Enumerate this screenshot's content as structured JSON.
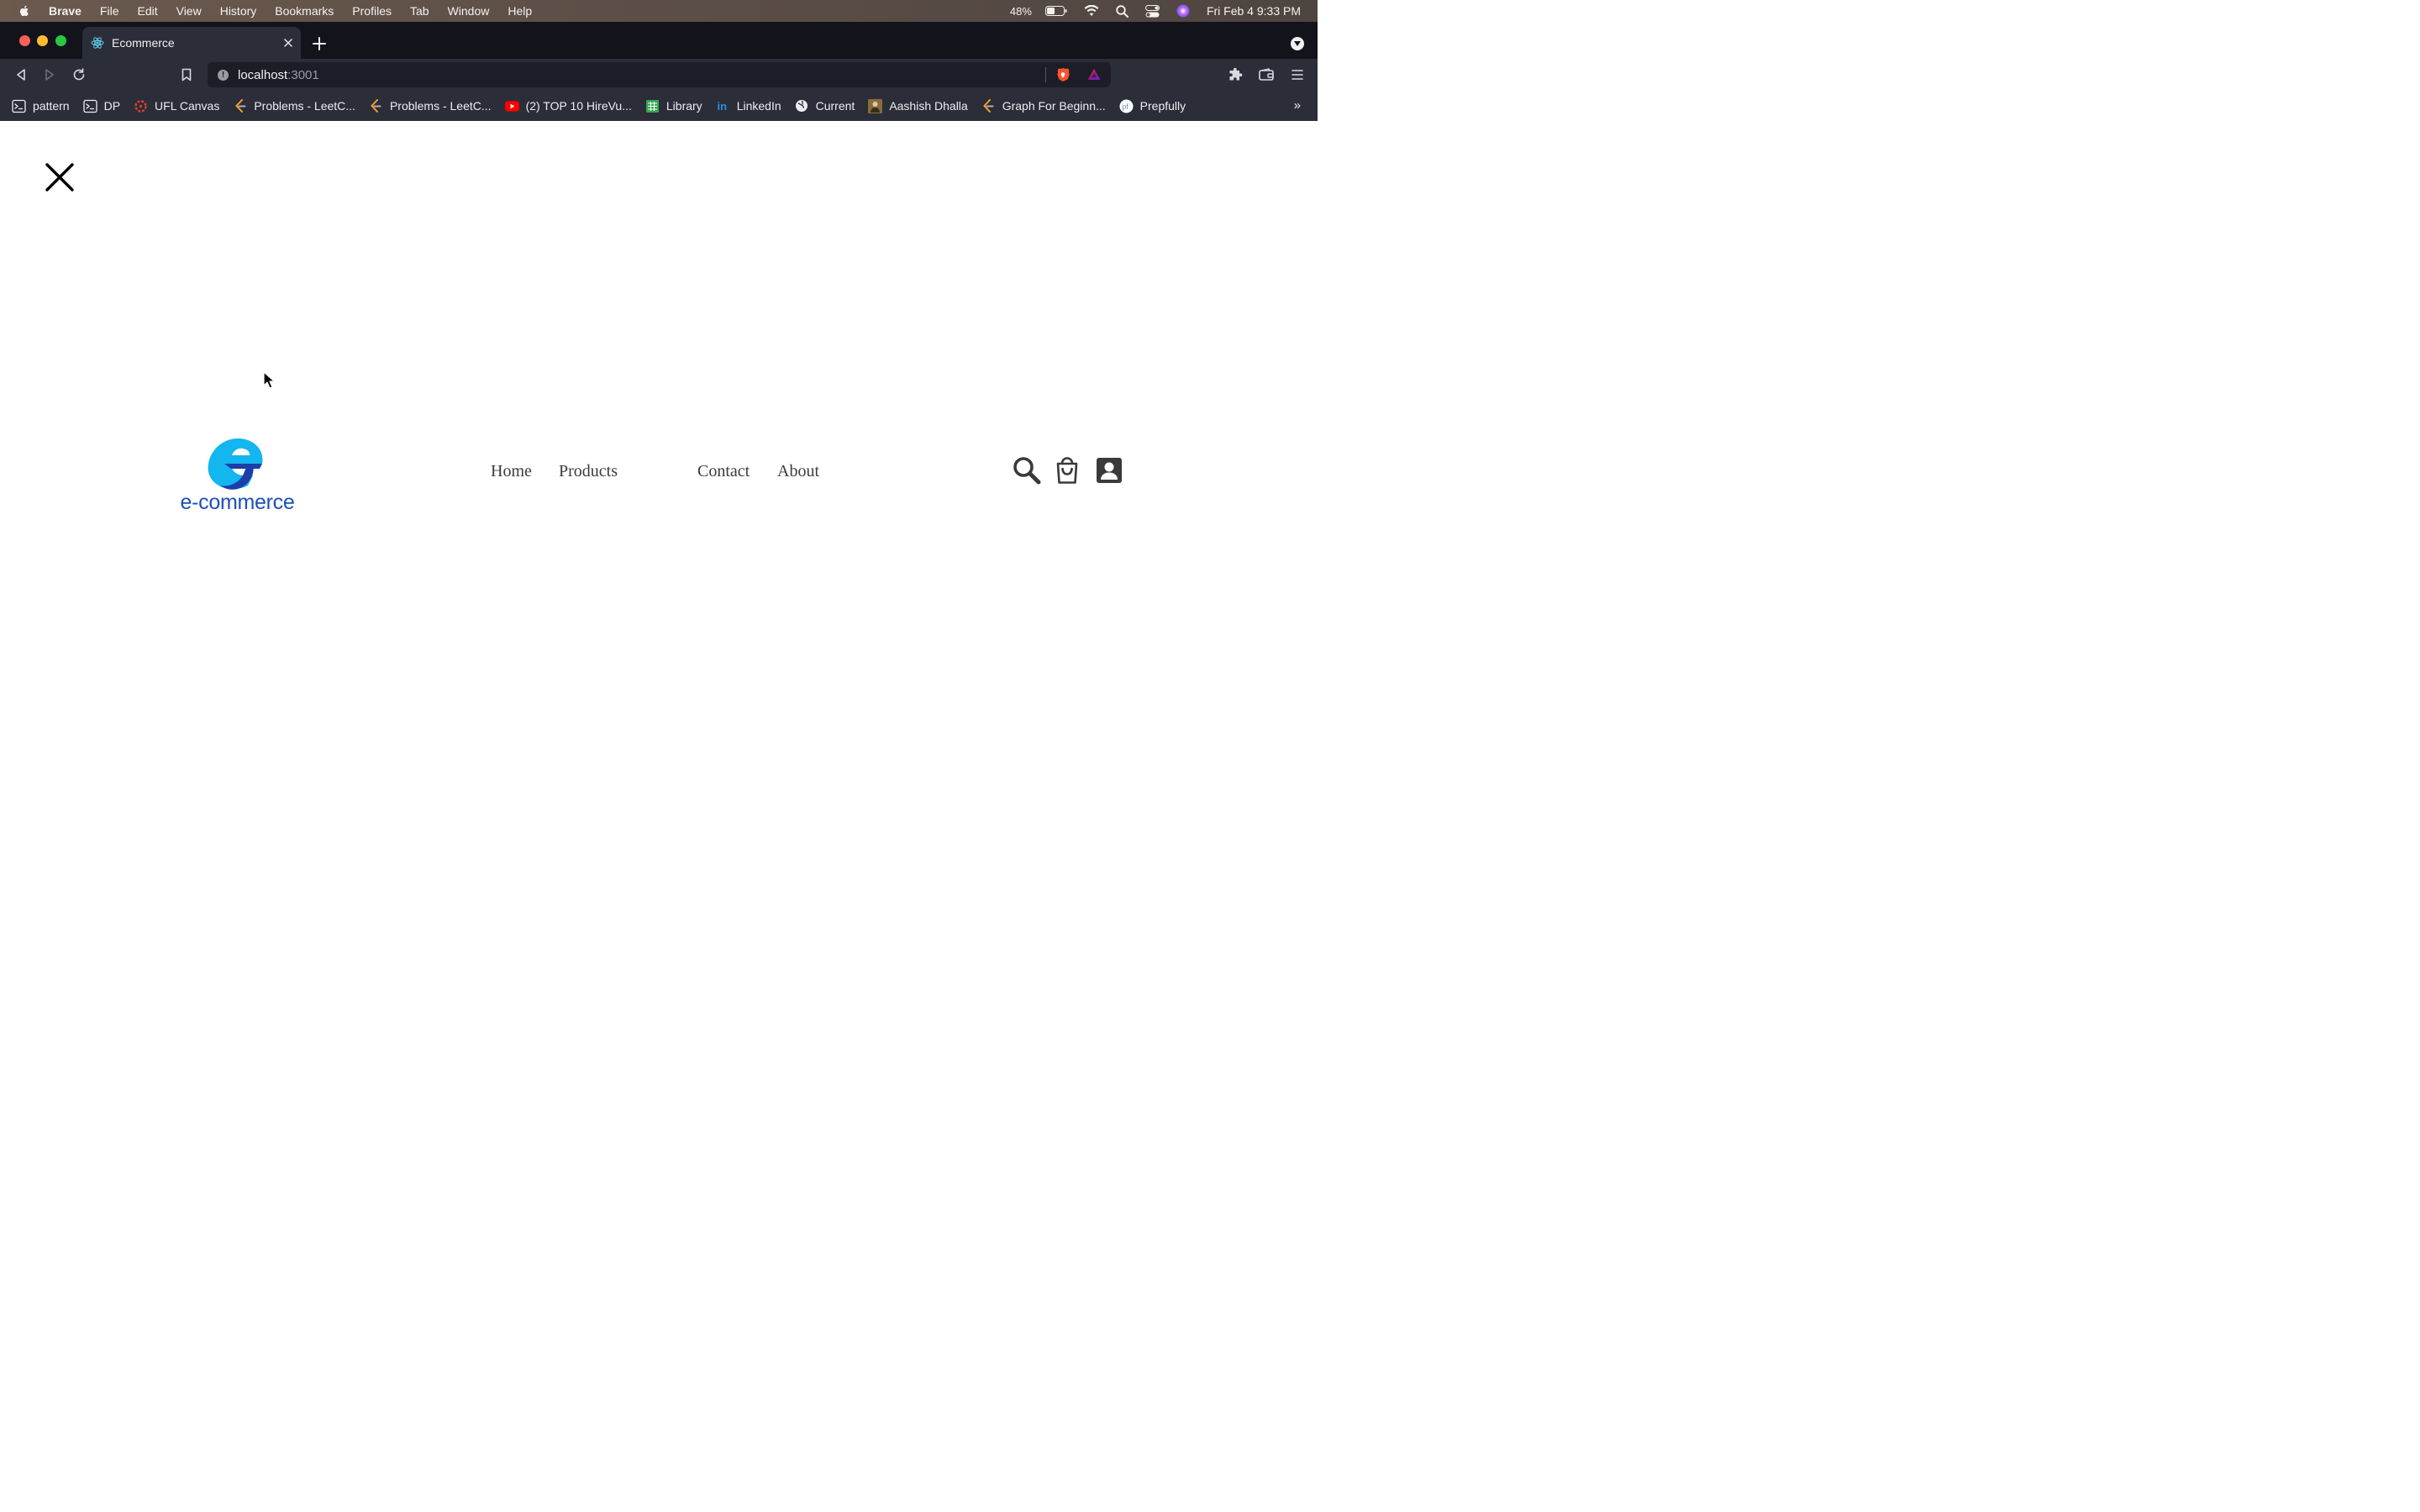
{
  "menubar": {
    "apple_icon": "apple-icon",
    "app_name": "Brave",
    "items": [
      "File",
      "Edit",
      "View",
      "History",
      "Bookmarks",
      "Profiles",
      "Tab",
      "Window",
      "Help"
    ],
    "battery_percent": "48%",
    "clock": "Fri Feb 4  9:33 PM"
  },
  "browser": {
    "tab_title": "Ecommerce",
    "url_host": "localhost",
    "url_port": ":3001",
    "bookmarks": [
      {
        "label": "pattern",
        "icon": "terminal-icon"
      },
      {
        "label": "DP",
        "icon": "terminal-icon"
      },
      {
        "label": "UFL Canvas",
        "icon": "canvas-icon"
      },
      {
        "label": "Problems - LeetC...",
        "icon": "leetcode-icon"
      },
      {
        "label": "Problems - LeetC...",
        "icon": "leetcode-icon"
      },
      {
        "label": "(2) TOP 10 HireVu...",
        "icon": "youtube-icon"
      },
      {
        "label": "Library",
        "icon": "sheet-icon"
      },
      {
        "label": "LinkedIn",
        "icon": "linkedin-icon"
      },
      {
        "label": "Current",
        "icon": "globe-icon"
      },
      {
        "label": "Aashish Dhalla",
        "icon": "avatar-icon"
      },
      {
        "label": "Graph For Beginn...",
        "icon": "leetcode-icon"
      },
      {
        "label": "Prepfully",
        "icon": "prepfully-icon"
      }
    ],
    "more_bookmarks": "»"
  },
  "page": {
    "logo_text": "e-commerce",
    "nav": {
      "home": "Home",
      "products": "Products",
      "contact": "Contact",
      "about": "About"
    },
    "colors": {
      "logo_blue_light": "#13b6ef",
      "logo_blue_dark": "#1e4fb8",
      "nav_text": "#3b3b3b",
      "icon_color": "#3a3a3a"
    }
  }
}
